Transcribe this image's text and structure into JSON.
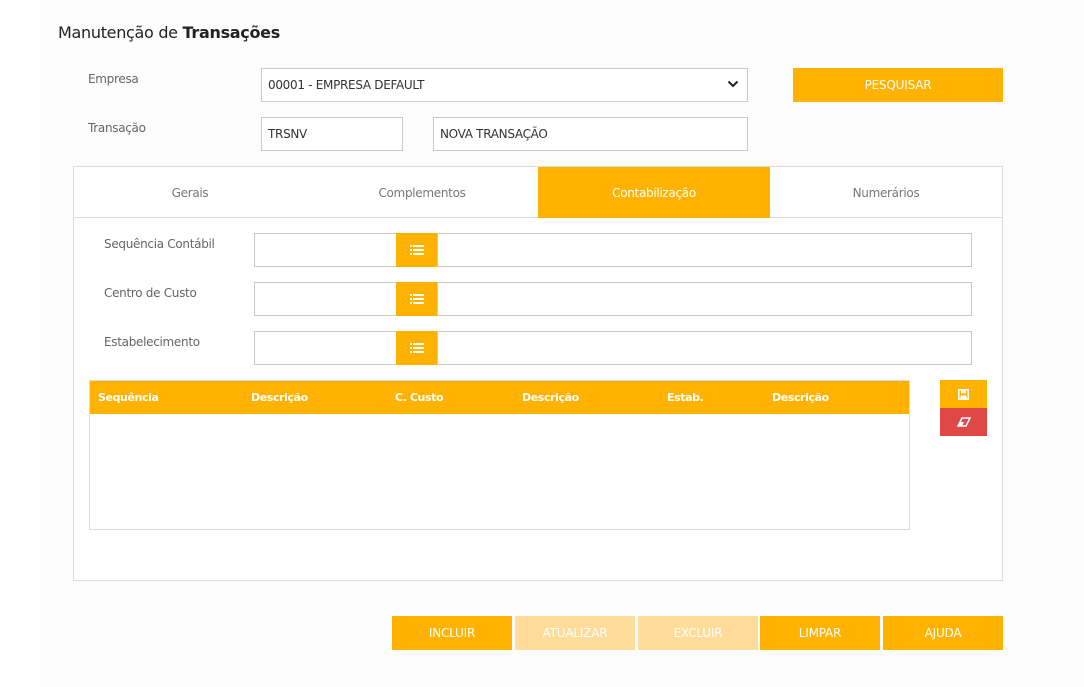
{
  "title": {
    "prefix": "Manutenção de",
    "bold": "Transações"
  },
  "form": {
    "empresa_label": "Empresa",
    "empresa_value": "00001 - EMPRESA DEFAULT",
    "pesquisar_label": "PESQUISAR",
    "transacao_label": "Transação",
    "transacao_code": "TRSNV",
    "transacao_name": "NOVA TRANSAÇÃO"
  },
  "tabs": [
    {
      "label": "Gerais",
      "active": false
    },
    {
      "label": "Complementos",
      "active": false
    },
    {
      "label": "Contabilização",
      "active": true
    },
    {
      "label": "Numerários",
      "active": false
    }
  ],
  "fields": {
    "sequencia_label": "Sequência Contábil",
    "centro_label": "Centro de Custo",
    "estab_label": "Estabelecimento"
  },
  "grid": {
    "headers": [
      "Sequência",
      "Descrição",
      "C. Custo",
      "Descrição",
      "Estab.",
      "Descrição"
    ],
    "rows": []
  },
  "side_buttons": {
    "save_icon": "save-icon",
    "eraser_icon": "eraser-icon"
  },
  "actions": {
    "incluir": "INCLUIR",
    "atualizar": "ATUALIZAR",
    "excluir": "EXCLUIR",
    "limpar": "LIMPAR",
    "ajuda": "AJUDA"
  },
  "colors": {
    "accent": "#ffb300",
    "accent_disabled": "#ffdc99",
    "danger": "#e04848"
  }
}
